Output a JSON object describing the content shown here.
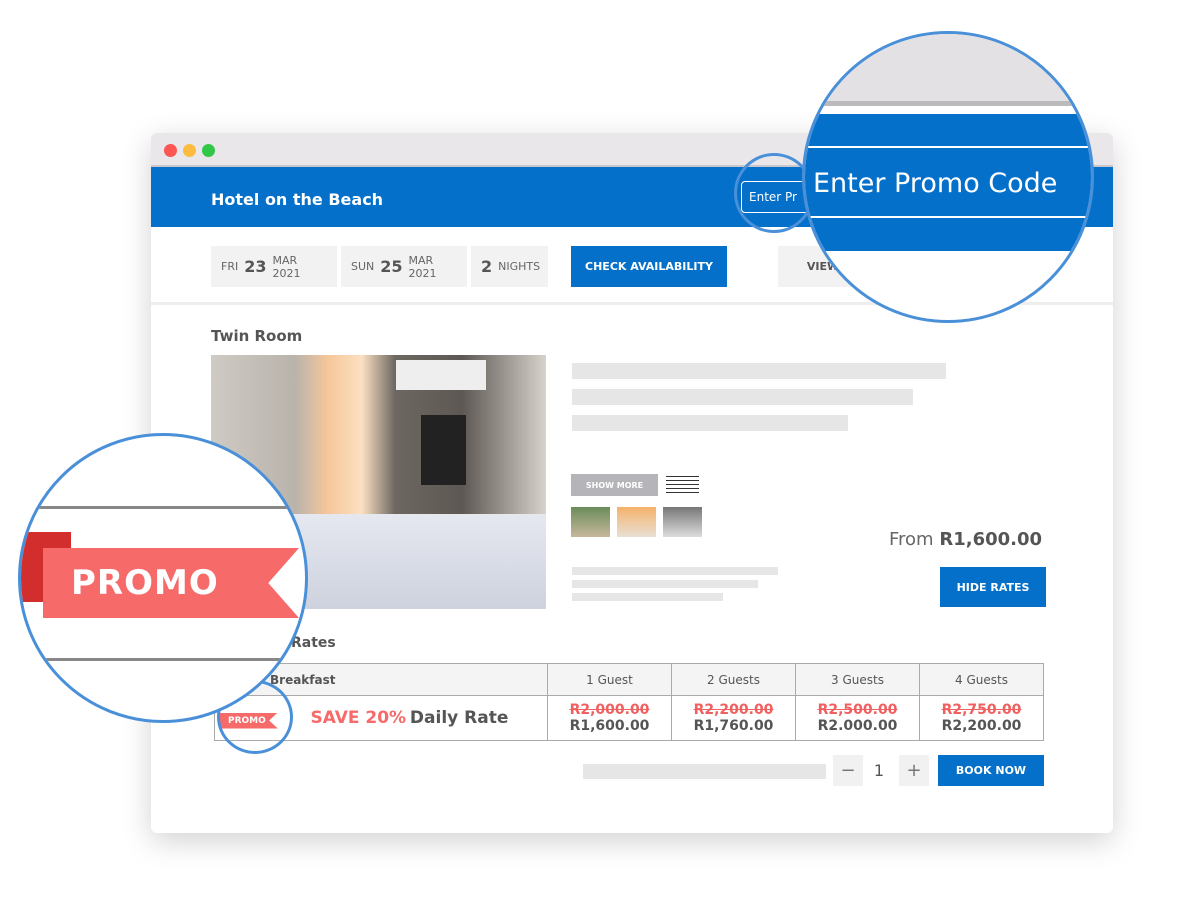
{
  "header": {
    "hotel_name": "Hotel on the Beach",
    "promo_placeholder": "Enter Promo Code",
    "promo_partial": "Enter Pr"
  },
  "dates": {
    "checkin": {
      "weekday": "FRI",
      "day": "23",
      "month_year": "MAR 2021"
    },
    "checkout": {
      "weekday": "SUN",
      "day": "25",
      "month_year": "MAR 2021"
    },
    "nights": {
      "count": "2",
      "label": "NIGHTS"
    },
    "check_label": "CHECK AVAILABILITY",
    "view_label": "VIEW"
  },
  "room": {
    "title": "Twin Room",
    "show_more": "SHOW MORE",
    "from_label": "From",
    "from_price": "R1,600.00",
    "hide_rates": "HIDE RATES"
  },
  "rates": {
    "title": "Rates",
    "column_header": "Breakfast",
    "guests": [
      "1 Guest",
      "2 Guests",
      "3 Guests",
      "4 Guests"
    ],
    "promo_tag": "PROMO",
    "save": "SAVE 20%",
    "rate_name": "Daily Rate",
    "old_prices": [
      "R2,000.00",
      "R2,200.00",
      "R2,500.00",
      "R2,750.00"
    ],
    "new_prices": [
      "R1,600.00",
      "R1,760.00",
      "R2.000.00",
      "R2,200.00"
    ]
  },
  "booking": {
    "minus": "−",
    "quantity": "1",
    "plus": "+",
    "book_label": "BOOK NOW"
  },
  "zoom_promo": {
    "label": "PROMO"
  },
  "colors": {
    "brand": "#0470c9",
    "promo": "#f76a6a",
    "callout": "#4a90d9"
  }
}
